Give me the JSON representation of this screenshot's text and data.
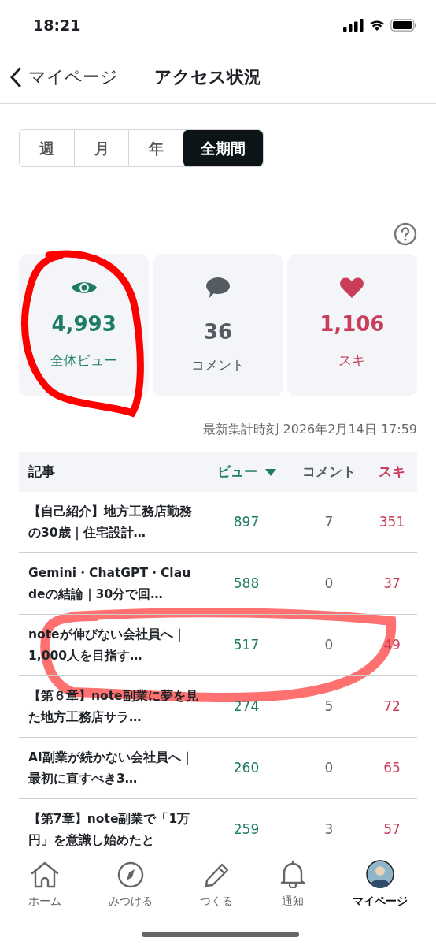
{
  "status_bar": {
    "time": "18:21"
  },
  "header": {
    "back_label": "マイページ",
    "title": "アクセス状況"
  },
  "period_tabs": [
    {
      "label": "週",
      "selected": false
    },
    {
      "label": "月",
      "selected": false
    },
    {
      "label": "年",
      "selected": false
    },
    {
      "label": "全期間",
      "selected": true
    }
  ],
  "stats": [
    {
      "kind": "views",
      "value": "4,993",
      "label": "全体ビュー",
      "color": "#1e7b65"
    },
    {
      "kind": "comments",
      "value": "36",
      "label": "コメント",
      "color": "#545b61"
    },
    {
      "kind": "likes",
      "value": "1,106",
      "label": "スキ",
      "color": "#c93d5b"
    }
  ],
  "updated_at": "最新集計時刻 2026年2月14日 17:59",
  "table": {
    "columns": [
      {
        "label": "記事",
        "color": "#1f2328",
        "sorted": false
      },
      {
        "label": "ビュー",
        "color": "#1e7b65",
        "sorted": true
      },
      {
        "label": "コメント",
        "color": "#545b61",
        "sorted": false
      },
      {
        "label": "スキ",
        "color": "#c93d5b",
        "sorted": false
      }
    ],
    "rows": [
      {
        "title": "【自己紹介】地方工務店勤務の30歳｜住宅設計…",
        "views": "897",
        "comments": "7",
        "likes": "351"
      },
      {
        "title": "Gemini・ChatGPT・Claudeの結論｜30分で回…",
        "views": "588",
        "comments": "0",
        "likes": "37"
      },
      {
        "title": "noteが伸びない会社員へ｜1,000人を目指す…",
        "views": "517",
        "comments": "0",
        "likes": "49"
      },
      {
        "title": "【第６章】note副業に夢を見た地方工務店サラ…",
        "views": "274",
        "comments": "5",
        "likes": "72"
      },
      {
        "title": "AI副業が続かない会社員へ｜最初に直すべき3…",
        "views": "260",
        "comments": "0",
        "likes": "65"
      },
      {
        "title": "【第7章】note副業で「1万円」を意識し始めたと",
        "views": "259",
        "comments": "3",
        "likes": "57"
      }
    ]
  },
  "bottom_nav": [
    {
      "kind": "home",
      "label": "ホーム",
      "selected": false
    },
    {
      "kind": "discover",
      "label": "みつける",
      "selected": false
    },
    {
      "kind": "create",
      "label": "つくる",
      "selected": false
    },
    {
      "kind": "notifications",
      "label": "通知",
      "selected": false
    },
    {
      "kind": "mypage",
      "label": "マイページ",
      "selected": true
    }
  ]
}
